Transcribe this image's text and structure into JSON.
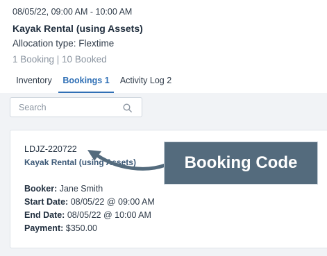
{
  "header": {
    "time_range": "08/05/22, 09:00 AM - 10:00 AM",
    "title": "Kayak Rental (using Assets)",
    "allocation_type": "Allocation type: Flextime",
    "summary": "1 Booking | 10 Booked"
  },
  "tabs": [
    {
      "label": "Inventory",
      "active": false
    },
    {
      "label": "Bookings 1",
      "active": true
    },
    {
      "label": "Activity Log 2",
      "active": false
    }
  ],
  "search": {
    "placeholder": "Search",
    "value": "",
    "icon": "search-icon"
  },
  "booking": {
    "code": "LDJZ-220722",
    "product": "Kayak Rental (using Assets)",
    "booker_label": "Booker:",
    "booker": "Jane Smith",
    "start_label": "Start Date:",
    "start": "08/05/22 @ 09:00 AM",
    "end_label": "End Date:",
    "end": "08/05/22 @ 10:00 AM",
    "payment_label": "Payment:",
    "payment": "$350.00"
  },
  "annotation": {
    "label": "Booking Code",
    "color": "#546b7d"
  },
  "colors": {
    "accent": "#2f6fb5",
    "content_bg": "#f1f3f6",
    "muted_text": "#8a94a0"
  }
}
